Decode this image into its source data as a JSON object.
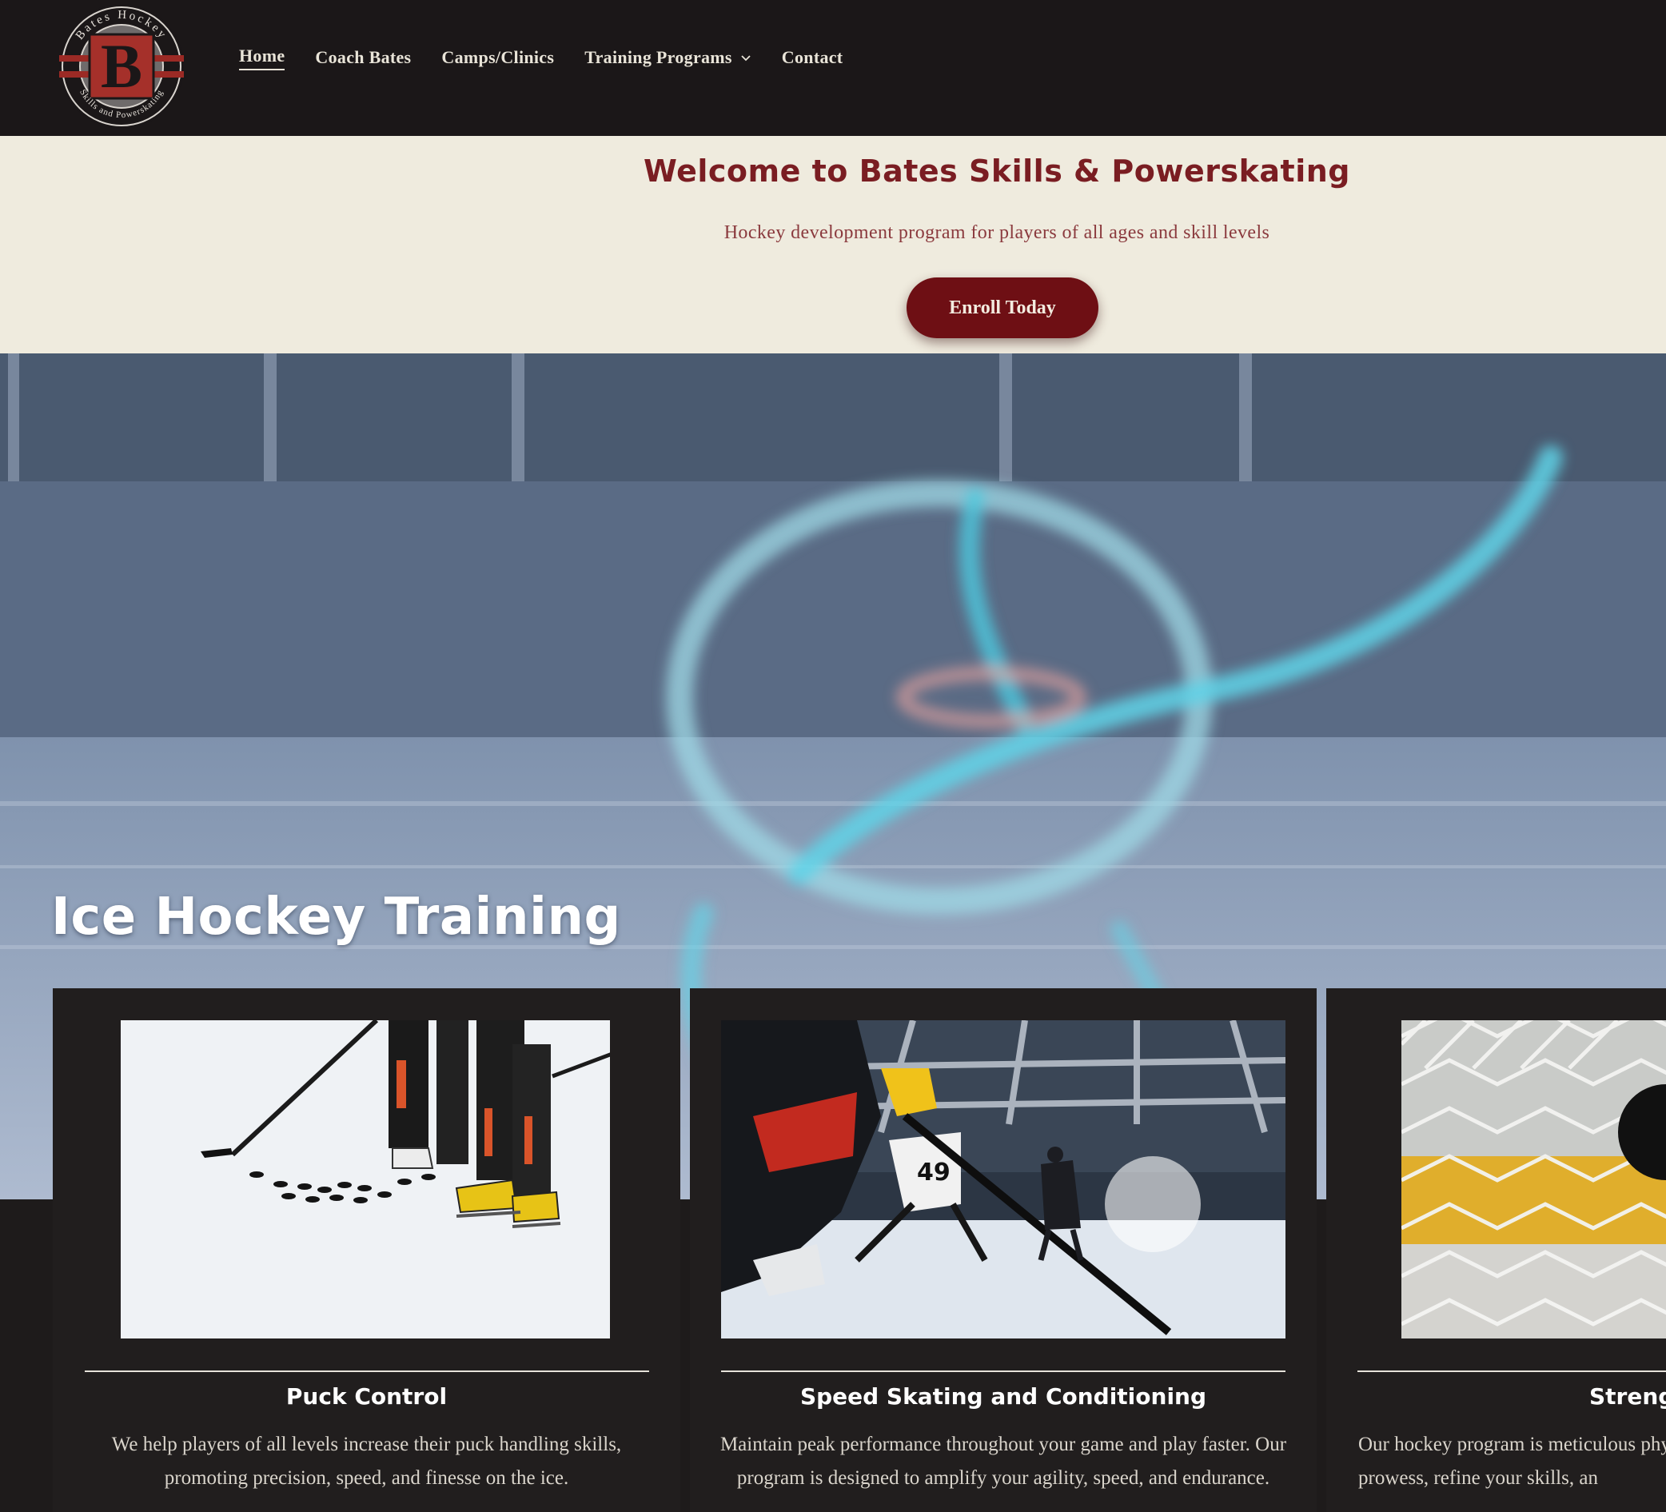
{
  "header": {
    "logo": {
      "letter": "B",
      "ring_top": "Bates Hockey",
      "ring_bottom": "Skills and Powerskating"
    },
    "nav": [
      {
        "label": "Home",
        "active": true
      },
      {
        "label": "Coach Bates"
      },
      {
        "label": "Camps/Clinics"
      },
      {
        "label": "Training Programs",
        "has_dropdown": true
      },
      {
        "label": "Contact"
      }
    ]
  },
  "welcome": {
    "title": "Welcome to Bates Skills & Powerskating",
    "subtitle": "Hockey development program for players of all ages and skill levels",
    "cta_label": "Enroll Today"
  },
  "hero": {
    "title": "Ice Hockey Training"
  },
  "cards": [
    {
      "title": "Puck Control",
      "text": "We help players of all levels increase their puck handling skills, promoting precision, speed, and finesse on the ice.",
      "image_icon": "pucks-on-ice-image"
    },
    {
      "title": "Speed Skating and Conditioning",
      "text": "Maintain peak performance throughout your game and play faster. Our program is designed to amplify your agility, speed, and endurance.",
      "image_icon": "skaters-action-image"
    },
    {
      "title": "Streng",
      "text": "Our hockey program is meticulous physica prowess, refine your skills, an",
      "image_icon": "hockey-net-image"
    }
  ],
  "colors": {
    "header_bg": "#1b1718",
    "welcome_bg": "#efebde",
    "brand_maroon": "#6e0f14",
    "title_maroon": "#7a1d22",
    "card_bg": "#211e1e"
  }
}
